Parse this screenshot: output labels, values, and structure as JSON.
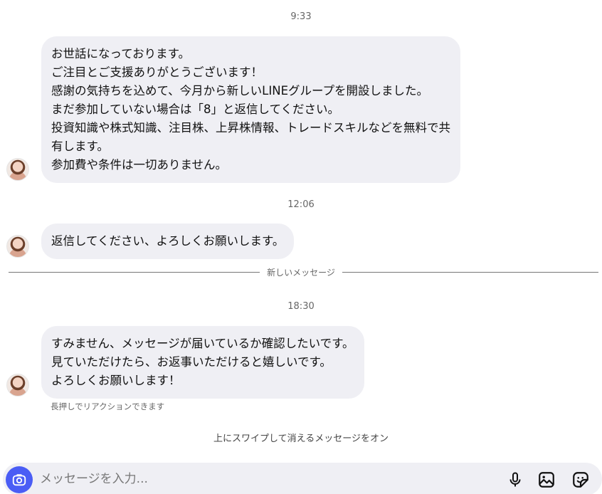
{
  "thread": [
    {
      "timestamp": "9:33",
      "lines": [
        "お世話になっております。",
        "ご注目とご支援ありがとうございます！",
        "感謝の気持ちを込めて、今月から新しいLINEグループを開設しました。",
        "まだ参加していない場合は「8」と返信してください。",
        "投資知識や株式知識、注目株、上昇株情報、トレードスキルなどを無料で共",
        "有します。",
        "参加費や条件は一切ありません。"
      ]
    },
    {
      "timestamp": "12:06",
      "lines": [
        "返信してください、よろしくお願いします。"
      ]
    },
    {
      "timestamp": "18:30",
      "lines": [
        "すみません、メッセージが届いているか確認したいです。",
        "見ていただけたら、お返事いただけると嬉しいです。",
        "よろしくお願いします！"
      ]
    }
  ],
  "divider_label": "新しいメッセージ",
  "reaction_hint": "長押しでリアクションできます",
  "swipe_hint": "上にスワイプして消えるメッセージをオン",
  "composer": {
    "placeholder": "メッセージを入力..."
  },
  "icons": {
    "camera": "camera-icon",
    "mic": "microphone-icon",
    "gallery": "image-icon",
    "sticker": "sticker-icon"
  },
  "colors": {
    "accent": "#4a5df5",
    "bubble": "#efeff4"
  }
}
